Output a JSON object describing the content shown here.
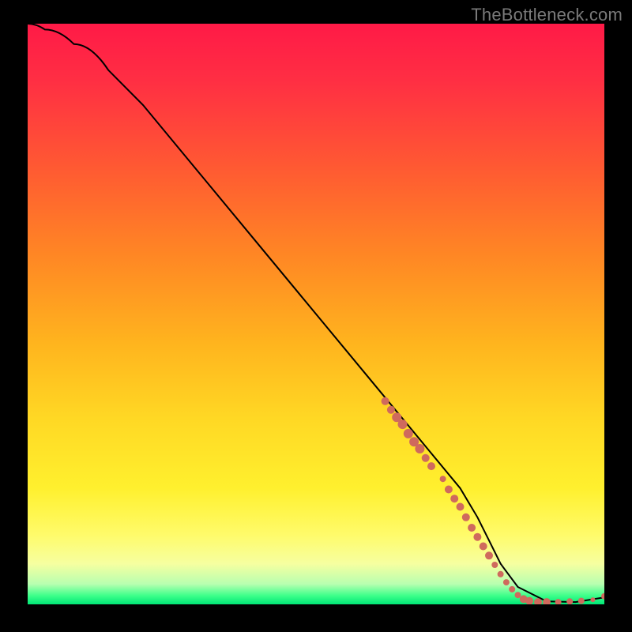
{
  "watermark": "TheBottleneck.com",
  "gradient": {
    "stops": [
      {
        "offset": 0.0,
        "color": "#ff1a47"
      },
      {
        "offset": 0.1,
        "color": "#ff2f43"
      },
      {
        "offset": 0.25,
        "color": "#ff5a32"
      },
      {
        "offset": 0.4,
        "color": "#ff8724"
      },
      {
        "offset": 0.55,
        "color": "#ffb41e"
      },
      {
        "offset": 0.68,
        "color": "#ffd824"
      },
      {
        "offset": 0.8,
        "color": "#fff02e"
      },
      {
        "offset": 0.88,
        "color": "#fffb6a"
      },
      {
        "offset": 0.93,
        "color": "#f6ffa0"
      },
      {
        "offset": 0.965,
        "color": "#b8ffb0"
      },
      {
        "offset": 0.985,
        "color": "#3dff8a"
      },
      {
        "offset": 1.0,
        "color": "#00e676"
      }
    ]
  },
  "chart_data": {
    "type": "line",
    "title": "",
    "xlabel": "",
    "ylabel": "",
    "xlim": [
      0,
      100
    ],
    "ylim": [
      0,
      100
    ],
    "grid": false,
    "legend": false,
    "series": [
      {
        "name": "bottleneck-curve",
        "smooth_start": true,
        "x": [
          0,
          3,
          8,
          14,
          20,
          30,
          40,
          50,
          60,
          70,
          75,
          78,
          80,
          82,
          85,
          90,
          95,
          100
        ],
        "y": [
          100,
          99,
          96.5,
          92,
          86,
          74,
          62,
          50,
          38,
          26,
          20,
          15,
          11,
          7,
          3,
          0.5,
          0.4,
          1.2
        ]
      }
    ],
    "points": {
      "name": "marker-points",
      "color": "#cf6a5d",
      "items": [
        {
          "x": 62,
          "y": 35.0,
          "r": 5
        },
        {
          "x": 63,
          "y": 33.5,
          "r": 5
        },
        {
          "x": 64,
          "y": 32.2,
          "r": 6
        },
        {
          "x": 65,
          "y": 31.0,
          "r": 6
        },
        {
          "x": 66,
          "y": 29.4,
          "r": 6
        },
        {
          "x": 67,
          "y": 28.0,
          "r": 6
        },
        {
          "x": 68,
          "y": 26.8,
          "r": 6
        },
        {
          "x": 69,
          "y": 25.2,
          "r": 5
        },
        {
          "x": 70,
          "y": 23.8,
          "r": 5
        },
        {
          "x": 72,
          "y": 21.6,
          "r": 4
        },
        {
          "x": 73,
          "y": 19.8,
          "r": 5
        },
        {
          "x": 74,
          "y": 18.2,
          "r": 5
        },
        {
          "x": 75,
          "y": 16.8,
          "r": 5
        },
        {
          "x": 76,
          "y": 15.0,
          "r": 5
        },
        {
          "x": 77,
          "y": 13.2,
          "r": 5
        },
        {
          "x": 78,
          "y": 11.6,
          "r": 5
        },
        {
          "x": 79,
          "y": 10.0,
          "r": 5
        },
        {
          "x": 80,
          "y": 8.4,
          "r": 5
        },
        {
          "x": 81,
          "y": 6.8,
          "r": 4
        },
        {
          "x": 82,
          "y": 5.2,
          "r": 4
        },
        {
          "x": 83,
          "y": 3.8,
          "r": 4
        },
        {
          "x": 84,
          "y": 2.6,
          "r": 4
        },
        {
          "x": 85,
          "y": 1.6,
          "r": 4
        },
        {
          "x": 86,
          "y": 0.9,
          "r": 5
        },
        {
          "x": 87,
          "y": 0.6,
          "r": 5
        },
        {
          "x": 88.5,
          "y": 0.4,
          "r": 5
        },
        {
          "x": 90,
          "y": 0.4,
          "r": 5
        },
        {
          "x": 92,
          "y": 0.4,
          "r": 4
        },
        {
          "x": 94,
          "y": 0.5,
          "r": 4
        },
        {
          "x": 96,
          "y": 0.6,
          "r": 4
        },
        {
          "x": 98,
          "y": 0.8,
          "r": 3
        },
        {
          "x": 100,
          "y": 1.4,
          "r": 4
        }
      ]
    }
  }
}
